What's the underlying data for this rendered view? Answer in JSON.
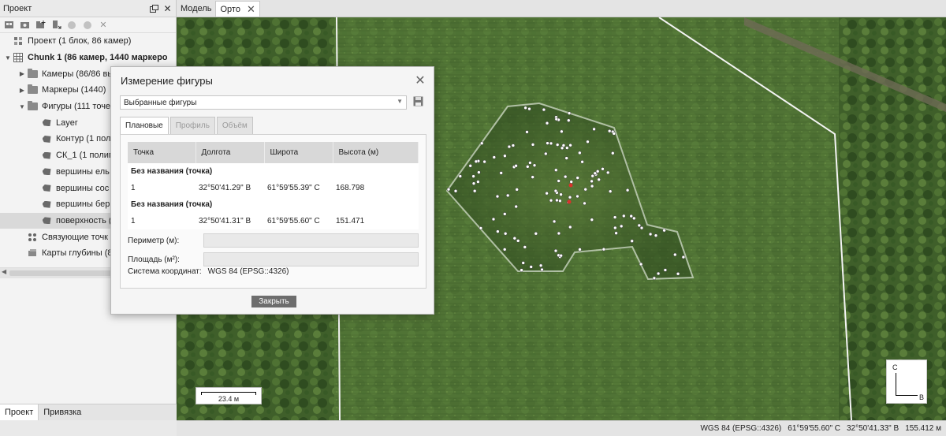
{
  "project_panel": {
    "title": "Проект",
    "tree": [
      {
        "label": "Проект (1 блок, 86 камер)",
        "icon": "project-icon",
        "level": 0
      },
      {
        "label": "Chunk 1 (86 камер, 1440 маркеро",
        "icon": "chunk-icon",
        "level": 0,
        "bold": true,
        "expanded": true
      },
      {
        "label": "Камеры (86/86 вы",
        "icon": "folder-icon",
        "level": 1
      },
      {
        "label": "Маркеры (1440)",
        "icon": "folder-icon",
        "level": 1
      },
      {
        "label": "Фигуры (111 точе",
        "icon": "folder-icon",
        "level": 1,
        "expanded": true
      },
      {
        "label": "Layer",
        "icon": "shape-layer-icon",
        "level": 2
      },
      {
        "label": "Контур (1 пол",
        "icon": "shape-layer-icon",
        "level": 2
      },
      {
        "label": "СК_1 (1 полиг",
        "icon": "shape-layer-icon",
        "level": 2
      },
      {
        "label": "вершины ель",
        "icon": "shape-layer-icon",
        "level": 2
      },
      {
        "label": "вершины сос",
        "icon": "shape-layer-icon",
        "level": 2
      },
      {
        "label": "вершины бер",
        "icon": "shape-layer-icon",
        "level": 2
      },
      {
        "label": "поверхность (",
        "icon": "shape-layer-icon",
        "level": 2,
        "selected": true
      },
      {
        "label": "Связующие точк",
        "icon": "tiepoints-icon",
        "level": 1
      },
      {
        "label": "Карты глубины (8",
        "icon": "depth-maps-icon",
        "level": 1
      }
    ],
    "bottom_tabs": [
      "Проект",
      "Привязка"
    ]
  },
  "view_tabs": [
    "Модель",
    "Орто"
  ],
  "active_view": "Орто",
  "dialog": {
    "title": "Измерение фигуры",
    "selector_value": "Выбранные фигуры",
    "tabs": [
      {
        "label": "Плановые",
        "active": true
      },
      {
        "label": "Профиль",
        "active": false
      },
      {
        "label": "Объём",
        "active": false
      }
    ],
    "table": {
      "headers": [
        "Точка",
        "Долгота",
        "Широта",
        "Высота (м)"
      ],
      "groups": [
        {
          "name": "Без названия (точка)",
          "row": [
            "1",
            "32°50'41.29\" В",
            "61°59'55.39\" С",
            "168.798"
          ]
        },
        {
          "name": "Без названия (точка)",
          "row": [
            "1",
            "32°50'41.31\" В",
            "61°59'55.60\" С",
            "151.471"
          ]
        }
      ]
    },
    "perimeter_label": "Периметр (м):",
    "area_label": "Площадь (м²):",
    "crs_label": "Система координат:",
    "crs_value": "WGS 84 (EPSG::4326)",
    "close_label": "Закрыть"
  },
  "map": {
    "scale_text": "23.4 м",
    "north_label": "С",
    "east_label": "В"
  },
  "status_bar": {
    "crs": "WGS 84 (EPSG::4326)",
    "lat": "61°59'55.60\" С",
    "lon": "32°50'41.33\" В",
    "height": "155.412 м"
  }
}
